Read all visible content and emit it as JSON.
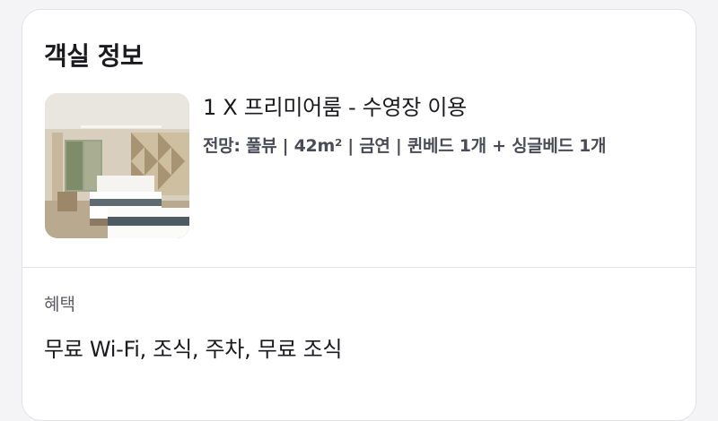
{
  "room_info": {
    "title": "객실 정보",
    "photo_icon": "hotel-room-photo",
    "room_name": "1 X 프리미어룸 - 수영장 이용",
    "details": "전망: 풀뷰 | 42m² | 금연 | 퀸베드 1개 + 싱글베드 1개"
  },
  "benefits": {
    "label": "혜택",
    "value": "무료 Wi-Fi, 조식, 주차, 무료 조식"
  },
  "colors": {
    "background": "#f4f4f6",
    "card": "#ffffff",
    "text_primary": "#1b1b1f",
    "text_secondary": "#4b4b57",
    "divider": "#e2e2e6"
  }
}
